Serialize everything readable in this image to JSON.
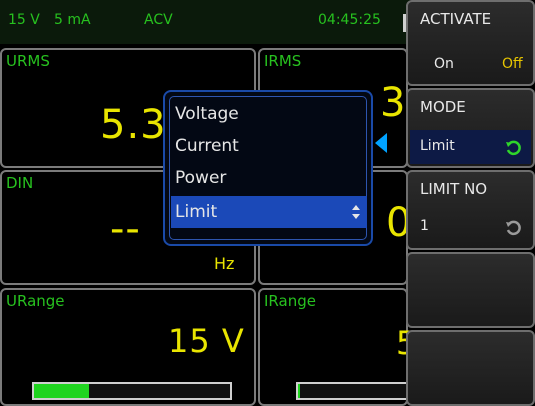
{
  "status": {
    "voltage_range": "15 V",
    "current_range": "5 mA",
    "mode": "ACV",
    "time": "04:45:25"
  },
  "tiles": {
    "urms": {
      "label": "URMS",
      "value_fragment": "5.3"
    },
    "irms": {
      "label": "IRMS",
      "value_fragment": "3"
    },
    "din": {
      "label": "DIN",
      "value_fragment": "--",
      "unit": "Hz"
    },
    "din_right": {
      "value_fragment": "0"
    },
    "urange": {
      "label": "URange",
      "value": "15 V",
      "level": 0.28
    },
    "irange": {
      "label": "IRange",
      "value_fragment": "5",
      "level": 0.02
    }
  },
  "popup": {
    "items": [
      "Voltage",
      "Current",
      "Power",
      "Limit"
    ],
    "selected_index": 3
  },
  "softkeys": {
    "activate": {
      "title": "ACTIVATE",
      "on": "On",
      "off": "Off"
    },
    "mode": {
      "title": "MODE",
      "value": "Limit"
    },
    "limit_no": {
      "title": "LIMIT NO",
      "value": "1"
    }
  },
  "colors": {
    "status_text": "#27c11f",
    "value_yellow": "#e9e500",
    "selection_blue": "#1b49b8",
    "pointer_cyan": "#00a2ff",
    "bar_green": "#1fd41f",
    "off_yellow": "#e6c400"
  }
}
